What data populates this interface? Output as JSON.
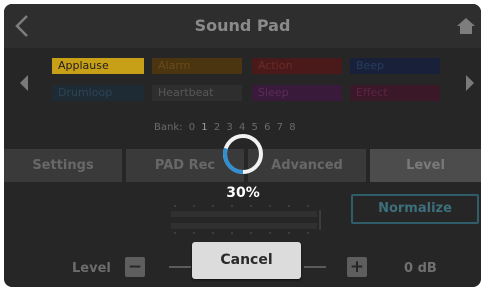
{
  "header": {
    "title": "Sound Pad"
  },
  "pads": [
    {
      "label": "Applause",
      "color": "#c8a018",
      "text_color": "#1e1e1e"
    },
    {
      "label": "Alarm",
      "color": "#4a3510",
      "text_color": "#6a4a18"
    },
    {
      "label": "Action",
      "color": "#4a1a1a",
      "text_color": "#6a2a28"
    },
    {
      "label": "Beep",
      "color": "#18203a",
      "text_color": "#263c5c"
    },
    {
      "label": "Drumloop",
      "color": "#1e2a34",
      "text_color": "#2e4454"
    },
    {
      "label": "Heartbeat",
      "color": "#2e2e2e",
      "text_color": "#585858"
    },
    {
      "label": "Sleep",
      "color": "#3a1a3a",
      "text_color": "#5c2c5a"
    },
    {
      "label": "Effect",
      "color": "#3a1828",
      "text_color": "#5c2444"
    }
  ],
  "bank": {
    "label": "Bank:",
    "numbers": [
      "0",
      "1",
      "2",
      "3",
      "4",
      "5",
      "6",
      "7",
      "8"
    ]
  },
  "tabs": [
    {
      "label": "Settings"
    },
    {
      "label": "PAD Rec"
    },
    {
      "label": "Advanced"
    },
    {
      "label": "Level"
    }
  ],
  "normalize_label": "Normalize",
  "level": {
    "label": "Level",
    "value": "0 dB",
    "minus": "−",
    "plus": "+"
  },
  "progress": {
    "percent_text": "30%",
    "fraction": 0.3,
    "color": "#2f8fd0"
  },
  "cancel_label": "Cancel"
}
